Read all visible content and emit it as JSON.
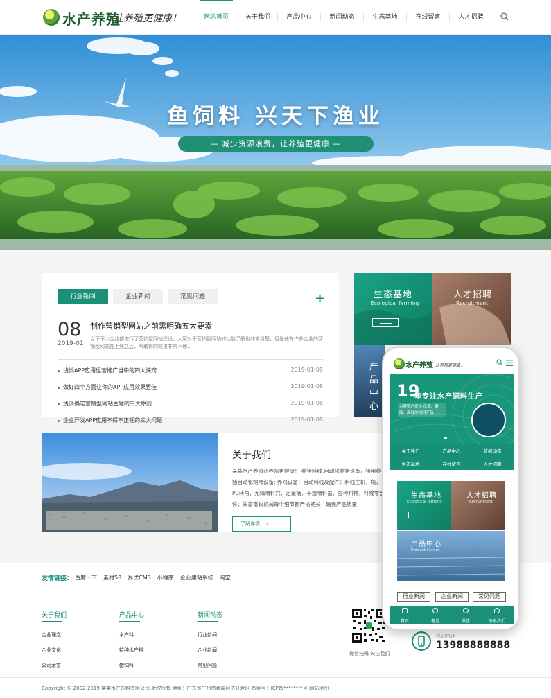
{
  "header": {
    "logo_text": "水产养殖",
    "slogan": "让养殖更健康！",
    "nav": [
      "网站首页",
      "关于我们",
      "产品中心",
      "新闻动态",
      "生态基地",
      "在线留言",
      "人才招聘"
    ],
    "search_icon": "search-icon"
  },
  "banner": {
    "title": "鱼饲料  兴天下渔业",
    "subtitle": "— 减少资源浪费，让养殖更健康 —"
  },
  "news": {
    "tabs": [
      "行业新闻",
      "企业新闻",
      "常见问题"
    ],
    "more_icon": "+",
    "featured": {
      "day": "08",
      "year_month": "2019-01",
      "title": "制作营销型网站之前需明确五大要素",
      "desc": "当下不少企业都进行了营销型网站建设，大家对于营销型网站的功能了解也非常清楚，但是任有许多企业的营销型网站在上线之后，所取得的效果非常不理..."
    },
    "items": [
      {
        "title": "浅谈APP应用运营推广当中的四大诀窍",
        "date": "2019-01-08"
      },
      {
        "title": "做好四个方面让你的APP应用效果更佳",
        "date": "2019-01-08"
      },
      {
        "title": "浅谈确定营销型网站主题的三大原则",
        "date": "2019-01-08"
      },
      {
        "title": "企业开发APP应用不得不正视的三大问题",
        "date": "2019-01-08"
      }
    ]
  },
  "about": {
    "title": "关于我们",
    "desc": "某某水产养殖让养殖更健康！ 养猪料线,自动化养猪设备，猪用养猪自动化饲喂设备; 养鸡设备：自动料线及配件：料线主机，角，PC转角，无绳喂料穴，定量桶，干湿喂料器，各种料槽，料线零部件；牧畜畜牧机械每个细节都严格把关，确保产品质量",
    "more_label": "了解详情"
  },
  "tiles": {
    "eco": {
      "title": "生态基地",
      "sub": "Ecological farming"
    },
    "recruit": {
      "title": "人才招聘",
      "sub": "Recruitment"
    },
    "product": {
      "title": "产品中心",
      "sub": "Product Center"
    }
  },
  "friend_links": {
    "label": "友情链接：",
    "items": [
      "百度一下",
      "素材58",
      "易优CMS",
      "小程序",
      "企业建站系统",
      "淘宝"
    ]
  },
  "footer": {
    "cols": [
      {
        "title": "关于我们",
        "items": [
          "企业理念",
          "企业文化",
          "公司荣誉"
        ]
      },
      {
        "title": "产品中心",
        "items": [
          "水产料",
          "特种水产料",
          "猪饲料"
        ]
      },
      {
        "title": "新闻动态",
        "items": [
          "行业新闻",
          "企业新闻",
          "常见问题"
        ]
      }
    ],
    "qr_caption": "微信扫码 关注我们",
    "phone_label": "移动电话",
    "phone": "13988888888",
    "copyright": "Copyright © 2002-2019 某某水产饲料有限公司 版权所有   地址：广东省广州市番禺经济开发区   备案号：ICP备********号   网站地图"
  },
  "mobile": {
    "logo_text": "水产养殖",
    "slogan": "让养殖更健康！",
    "big": "19",
    "headline": "年专注水产饲料生产",
    "sub": "为养殖户提供 优质、健康、高效的饲料产品",
    "nav": [
      "关于我们",
      "产品中心",
      "新闻动态",
      "生态基地",
      "在线留言",
      "人才招聘"
    ],
    "tabs": [
      "行业新闻",
      "企业新闻",
      "常见问题"
    ],
    "bottom": [
      "首页",
      "电话",
      "微信",
      "联系我们"
    ]
  },
  "colors": {
    "brand": "#1a9078",
    "brand_dark": "#17967a"
  }
}
